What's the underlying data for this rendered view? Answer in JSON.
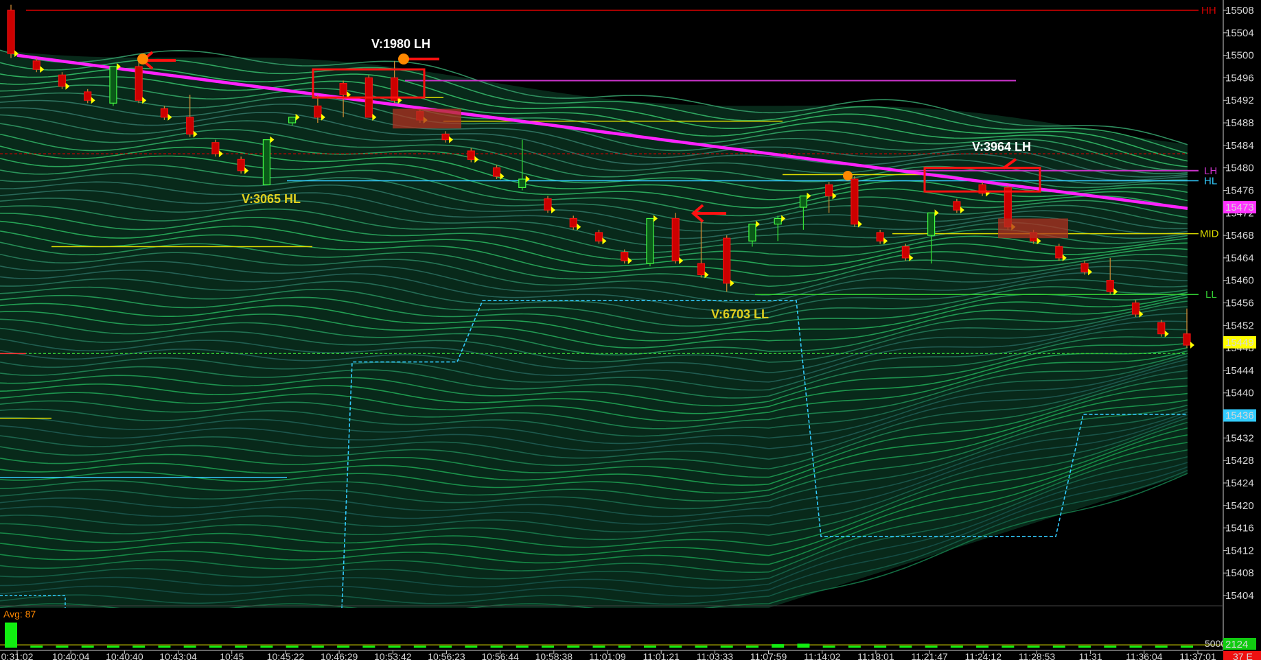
{
  "chart_data": {
    "type": "candlestick",
    "y_axis": {
      "ticks": [
        15508,
        15504,
        15500,
        15496,
        15492,
        15488,
        15484,
        15480,
        15476,
        15472,
        15468,
        15464,
        15460,
        15456,
        15452,
        15448,
        15444,
        15440,
        15436,
        15432,
        15428,
        15424,
        15420,
        15416,
        15412,
        15408,
        15404
      ],
      "ylim": [
        15401.5,
        15509.5
      ]
    },
    "x_axis": {
      "labels": [
        "0:31:02",
        "10:40:04",
        "10:40:40",
        "10:43:04",
        "10:45",
        "10:45:22",
        "10:46:29",
        "10:53:42",
        "10:56:23",
        "10:56:44",
        "10:58:38",
        "11:01:09",
        "11:01:21",
        "11:03:33",
        "11:07:59",
        "11:14:02",
        "11:18:01",
        "11:21:47",
        "11:24:12",
        "11:28:53",
        "11:31",
        "11:36:04",
        "11:37:01"
      ]
    },
    "price_tags": [
      {
        "label": "15473",
        "bg": "#ff33ff",
        "fg": "#000000"
      },
      {
        "label": "15449",
        "bg": "#ffff00",
        "fg": "#000000"
      },
      {
        "label": "15436",
        "bg": "#33ccff",
        "fg": "#000000"
      }
    ],
    "levels": [
      {
        "label": "HH",
        "color": "#dd0000"
      },
      {
        "label": "LH",
        "color": "#cc33cc"
      },
      {
        "label": "HL",
        "color": "#33ccff"
      },
      {
        "label": "MID",
        "color": "#dddd00"
      },
      {
        "label": "LL",
        "color": "#33cc33"
      }
    ],
    "annotations": [
      {
        "text": "V:1980 LH",
        "color": "#ffffff"
      },
      {
        "text": "V:3065 HL",
        "color": "#e0d020"
      },
      {
        "text": "V:6703 LL",
        "color": "#e0d020"
      },
      {
        "text": "V:3964 LH",
        "color": "#ffffff"
      }
    ],
    "candles": [
      {
        "o": 15508,
        "h": 15509,
        "c": 15500.3,
        "l": 15499.5
      },
      {
        "o": 15499,
        "h": 15499.5,
        "c": 15497.5,
        "l": 15497
      },
      {
        "o": 15496.5,
        "h": 15497,
        "c": 15494.5,
        "l": 15494
      },
      {
        "o": 15493.5,
        "h": 15494,
        "c": 15492,
        "l": 15491.5
      },
      {
        "o": 15491.5,
        "h": 15498,
        "c": 15498,
        "l": 15491
      },
      {
        "o": 15498,
        "h": 15499.5,
        "c": 15492,
        "l": 15491.5
      },
      {
        "o": 15490.5,
        "h": 15491,
        "c": 15489,
        "l": 15488.5
      },
      {
        "o": 15489,
        "h": 15493,
        "c": 15486,
        "l": 15485.5
      },
      {
        "o": 15484.5,
        "h": 15485,
        "c": 15482.5,
        "l": 15482
      },
      {
        "o": 15481.5,
        "h": 15482,
        "c": 15479.5,
        "l": 15479
      },
      {
        "o": 15477,
        "h": 15485,
        "c": 15485,
        "l": 15477
      },
      {
        "o": 15488,
        "h": 15489,
        "c": 15489,
        "l": 15487.5
      },
      {
        "o": 15491,
        "h": 15493,
        "c": 15489,
        "l": 15488
      },
      {
        "o": 15495,
        "h": 15495.5,
        "c": 15493,
        "l": 15489
      },
      {
        "o": 15496,
        "h": 15496.5,
        "c": 15489,
        "l": 15489
      },
      {
        "o": 15496,
        "h": 15499,
        "c": 15492,
        "l": 15491.5
      },
      {
        "o": 15490,
        "h": 15490.5,
        "c": 15488.5,
        "l": 15488
      },
      {
        "o": 15486,
        "h": 15486.5,
        "c": 15485,
        "l": 15484.5
      },
      {
        "o": 15483,
        "h": 15483.5,
        "c": 15481.5,
        "l": 15481
      },
      {
        "o": 15480,
        "h": 15480.5,
        "c": 15478.5,
        "l": 15478
      },
      {
        "o": 15476.5,
        "h": 15485,
        "c": 15478,
        "l": 15476
      },
      {
        "o": 15474.5,
        "h": 15475,
        "c": 15472.5,
        "l": 15472
      },
      {
        "o": 15471,
        "h": 15471.5,
        "c": 15469.5,
        "l": 15469
      },
      {
        "o": 15468.5,
        "h": 15469,
        "c": 15467,
        "l": 15466.5
      },
      {
        "o": 15465,
        "h": 15465.5,
        "c": 15463.5,
        "l": 15463
      },
      {
        "o": 15463,
        "h": 15471,
        "c": 15471,
        "l": 15462.5
      },
      {
        "o": 15471,
        "h": 15472,
        "c": 15463.5,
        "l": 15463
      },
      {
        "o": 15463,
        "h": 15470.5,
        "c": 15461,
        "l": 15460.5
      },
      {
        "o": 15467.5,
        "h": 15468,
        "c": 15459.5,
        "l": 15458
      },
      {
        "o": 15467,
        "h": 15470,
        "c": 15470,
        "l": 15466
      },
      {
        "o": 15470,
        "h": 15471.5,
        "c": 15471,
        "l": 15467
      },
      {
        "o": 15473,
        "h": 15475,
        "c": 15475,
        "l": 15469
      },
      {
        "o": 15477,
        "h": 15477.5,
        "c": 15475,
        "l": 15472
      },
      {
        "o": 15478,
        "h": 15478.5,
        "c": 15470,
        "l": 15469.5
      },
      {
        "o": 15468.5,
        "h": 15469,
        "c": 15467,
        "l": 15466.5
      },
      {
        "o": 15466,
        "h": 15466.5,
        "c": 15464,
        "l": 15463.5
      },
      {
        "o": 15468,
        "h": 15472,
        "c": 15472,
        "l": 15463
      },
      {
        "o": 15474,
        "h": 15474.5,
        "c": 15472.5,
        "l": 15472
      },
      {
        "o": 15477,
        "h": 15477.5,
        "c": 15475.5,
        "l": 15475
      },
      {
        "o": 15476.5,
        "h": 15477,
        "c": 15469.5,
        "l": 15469
      },
      {
        "o": 15468.5,
        "h": 15469,
        "c": 15467,
        "l": 15466.5
      },
      {
        "o": 15466,
        "h": 15466.5,
        "c": 15464,
        "l": 15463.5
      },
      {
        "o": 15463,
        "h": 15463.5,
        "c": 15461.5,
        "l": 15461
      },
      {
        "o": 15460,
        "h": 15464,
        "c": 15458,
        "l": 15457.5
      },
      {
        "o": 15456,
        "h": 15456.5,
        "c": 15454,
        "l": 15453.5
      },
      {
        "o": 15452.5,
        "h": 15453,
        "c": 15450.5,
        "l": 15450
      },
      {
        "o": 15450.5,
        "h": 15455,
        "c": 15448.5,
        "l": 15448
      }
    ],
    "volume": {
      "avg_label": "Avg: 87",
      "scale_label": "5000",
      "last_label": "2124",
      "values": [
        2124,
        60,
        40,
        80,
        90,
        100,
        110,
        120,
        130,
        170,
        160,
        60,
        70,
        90,
        100,
        120,
        130,
        110,
        90,
        110,
        120,
        100,
        130,
        120,
        110,
        140,
        100,
        130,
        120,
        110,
        300,
        340,
        80,
        70,
        90,
        60,
        130,
        100,
        90,
        120,
        130,
        110,
        100,
        90,
        80,
        120,
        100
      ]
    },
    "footer_right_label": "37 E"
  }
}
